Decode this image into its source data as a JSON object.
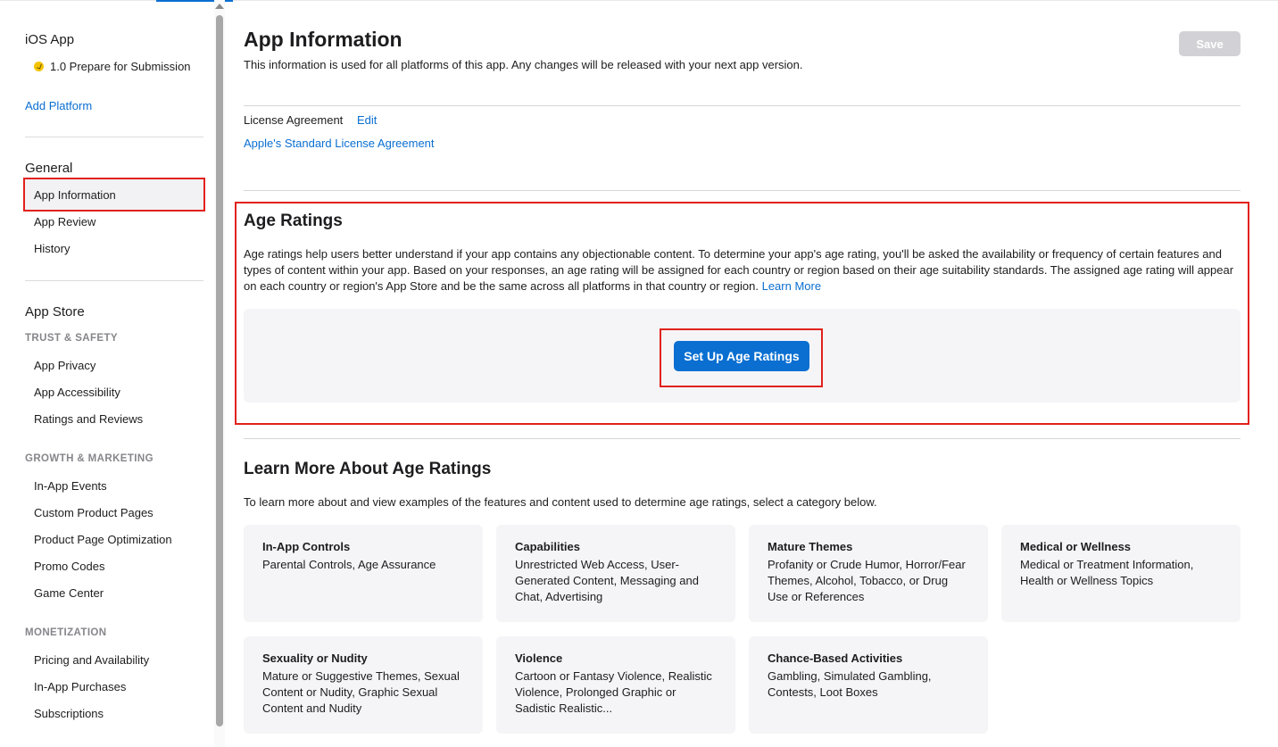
{
  "sidebar": {
    "platform_title": "iOS App",
    "version_label": "1.0 Prepare for Submission",
    "add_platform": "Add Platform",
    "general_title": "General",
    "general_items": [
      "App Information",
      "App Review",
      "History"
    ],
    "appstore_title": "App Store",
    "trust_safety": {
      "title": "TRUST & SAFETY",
      "items": [
        "App Privacy",
        "App Accessibility",
        "Ratings and Reviews"
      ]
    },
    "growth": {
      "title": "GROWTH & MARKETING",
      "items": [
        "In-App Events",
        "Custom Product Pages",
        "Product Page Optimization",
        "Promo Codes",
        "Game Center"
      ]
    },
    "monetization": {
      "title": "MONETIZATION",
      "items": [
        "Pricing and Availability",
        "In-App Purchases",
        "Subscriptions"
      ]
    }
  },
  "header": {
    "title": "App Information",
    "subtitle": "This information is used for all platforms of this app. Any changes will be released with your next app version.",
    "save_label": "Save"
  },
  "license": {
    "label": "License Agreement",
    "edit": "Edit",
    "link": "Apple's Standard License Agreement"
  },
  "age_ratings": {
    "title": "Age Ratings",
    "description": "Age ratings help users better understand if your app contains any objectionable content. To determine your app's age rating, you'll be asked the availability or frequency of certain features and types of content within your app. Based on your responses, an age rating will be assigned for each country or region based on their age suitability standards. The assigned age rating will appear on each country or region's App Store and be the same across all platforms in that country or region.",
    "learn_more": "Learn More",
    "setup_button": "Set Up Age Ratings"
  },
  "learn_more_section": {
    "title": "Learn More About Age Ratings",
    "subtitle": "To learn more about and view examples of the features and content used to determine age ratings, select a category below.",
    "cards": [
      {
        "title": "In-App Controls",
        "desc": "Parental Controls, Age Assurance"
      },
      {
        "title": "Capabilities",
        "desc": "Unrestricted Web Access, User-Generated Content, Messaging and Chat, Advertising"
      },
      {
        "title": "Mature Themes",
        "desc": "Profanity or Crude Humor, Horror/Fear Themes, Alcohol, Tobacco, or Drug Use or References"
      },
      {
        "title": "Medical or Wellness",
        "desc": "Medical or Treatment Information, Health or Wellness Topics"
      },
      {
        "title": "Sexuality or Nudity",
        "desc": "Mature or Suggestive Themes, Sexual Content or Nudity, Graphic Sexual Content and Nudity"
      },
      {
        "title": "Violence",
        "desc": "Cartoon or Fantasy Violence, Realistic Violence, Prolonged Graphic or Sadistic Realistic..."
      },
      {
        "title": "Chance-Based Activities",
        "desc": "Gambling, Simulated Gambling, Contests, Loot Boxes"
      }
    ]
  },
  "colors": {
    "accent": "#0a6fd1",
    "highlight": "#e2211c",
    "status_dot": "#f5c400"
  }
}
